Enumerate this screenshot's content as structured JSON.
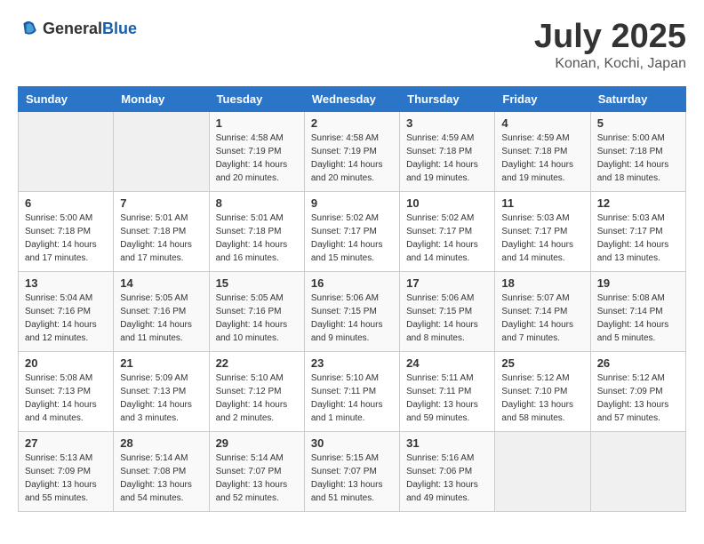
{
  "header": {
    "logo_general": "General",
    "logo_blue": "Blue",
    "month": "July 2025",
    "location": "Konan, Kochi, Japan"
  },
  "weekdays": [
    "Sunday",
    "Monday",
    "Tuesday",
    "Wednesday",
    "Thursday",
    "Friday",
    "Saturday"
  ],
  "weeks": [
    [
      {
        "day": "",
        "info": ""
      },
      {
        "day": "",
        "info": ""
      },
      {
        "day": "1",
        "info": "Sunrise: 4:58 AM\nSunset: 7:19 PM\nDaylight: 14 hours and 20 minutes."
      },
      {
        "day": "2",
        "info": "Sunrise: 4:58 AM\nSunset: 7:19 PM\nDaylight: 14 hours and 20 minutes."
      },
      {
        "day": "3",
        "info": "Sunrise: 4:59 AM\nSunset: 7:18 PM\nDaylight: 14 hours and 19 minutes."
      },
      {
        "day": "4",
        "info": "Sunrise: 4:59 AM\nSunset: 7:18 PM\nDaylight: 14 hours and 19 minutes."
      },
      {
        "day": "5",
        "info": "Sunrise: 5:00 AM\nSunset: 7:18 PM\nDaylight: 14 hours and 18 minutes."
      }
    ],
    [
      {
        "day": "6",
        "info": "Sunrise: 5:00 AM\nSunset: 7:18 PM\nDaylight: 14 hours and 17 minutes."
      },
      {
        "day": "7",
        "info": "Sunrise: 5:01 AM\nSunset: 7:18 PM\nDaylight: 14 hours and 17 minutes."
      },
      {
        "day": "8",
        "info": "Sunrise: 5:01 AM\nSunset: 7:18 PM\nDaylight: 14 hours and 16 minutes."
      },
      {
        "day": "9",
        "info": "Sunrise: 5:02 AM\nSunset: 7:17 PM\nDaylight: 14 hours and 15 minutes."
      },
      {
        "day": "10",
        "info": "Sunrise: 5:02 AM\nSunset: 7:17 PM\nDaylight: 14 hours and 14 minutes."
      },
      {
        "day": "11",
        "info": "Sunrise: 5:03 AM\nSunset: 7:17 PM\nDaylight: 14 hours and 14 minutes."
      },
      {
        "day": "12",
        "info": "Sunrise: 5:03 AM\nSunset: 7:17 PM\nDaylight: 14 hours and 13 minutes."
      }
    ],
    [
      {
        "day": "13",
        "info": "Sunrise: 5:04 AM\nSunset: 7:16 PM\nDaylight: 14 hours and 12 minutes."
      },
      {
        "day": "14",
        "info": "Sunrise: 5:05 AM\nSunset: 7:16 PM\nDaylight: 14 hours and 11 minutes."
      },
      {
        "day": "15",
        "info": "Sunrise: 5:05 AM\nSunset: 7:16 PM\nDaylight: 14 hours and 10 minutes."
      },
      {
        "day": "16",
        "info": "Sunrise: 5:06 AM\nSunset: 7:15 PM\nDaylight: 14 hours and 9 minutes."
      },
      {
        "day": "17",
        "info": "Sunrise: 5:06 AM\nSunset: 7:15 PM\nDaylight: 14 hours and 8 minutes."
      },
      {
        "day": "18",
        "info": "Sunrise: 5:07 AM\nSunset: 7:14 PM\nDaylight: 14 hours and 7 minutes."
      },
      {
        "day": "19",
        "info": "Sunrise: 5:08 AM\nSunset: 7:14 PM\nDaylight: 14 hours and 5 minutes."
      }
    ],
    [
      {
        "day": "20",
        "info": "Sunrise: 5:08 AM\nSunset: 7:13 PM\nDaylight: 14 hours and 4 minutes."
      },
      {
        "day": "21",
        "info": "Sunrise: 5:09 AM\nSunset: 7:13 PM\nDaylight: 14 hours and 3 minutes."
      },
      {
        "day": "22",
        "info": "Sunrise: 5:10 AM\nSunset: 7:12 PM\nDaylight: 14 hours and 2 minutes."
      },
      {
        "day": "23",
        "info": "Sunrise: 5:10 AM\nSunset: 7:11 PM\nDaylight: 14 hours and 1 minute."
      },
      {
        "day": "24",
        "info": "Sunrise: 5:11 AM\nSunset: 7:11 PM\nDaylight: 13 hours and 59 minutes."
      },
      {
        "day": "25",
        "info": "Sunrise: 5:12 AM\nSunset: 7:10 PM\nDaylight: 13 hours and 58 minutes."
      },
      {
        "day": "26",
        "info": "Sunrise: 5:12 AM\nSunset: 7:09 PM\nDaylight: 13 hours and 57 minutes."
      }
    ],
    [
      {
        "day": "27",
        "info": "Sunrise: 5:13 AM\nSunset: 7:09 PM\nDaylight: 13 hours and 55 minutes."
      },
      {
        "day": "28",
        "info": "Sunrise: 5:14 AM\nSunset: 7:08 PM\nDaylight: 13 hours and 54 minutes."
      },
      {
        "day": "29",
        "info": "Sunrise: 5:14 AM\nSunset: 7:07 PM\nDaylight: 13 hours and 52 minutes."
      },
      {
        "day": "30",
        "info": "Sunrise: 5:15 AM\nSunset: 7:07 PM\nDaylight: 13 hours and 51 minutes."
      },
      {
        "day": "31",
        "info": "Sunrise: 5:16 AM\nSunset: 7:06 PM\nDaylight: 13 hours and 49 minutes."
      },
      {
        "day": "",
        "info": ""
      },
      {
        "day": "",
        "info": ""
      }
    ]
  ]
}
